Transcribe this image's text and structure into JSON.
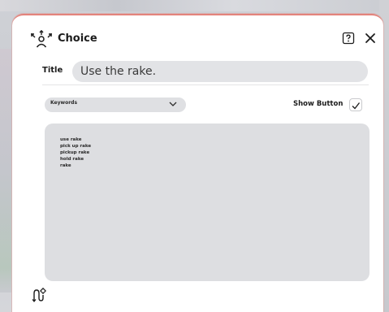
{
  "dialog": {
    "title": "Choice",
    "icons": {
      "header": "choice-people-icon",
      "help": "help-icon",
      "close": "close-icon",
      "footer": "flow-add-icon"
    },
    "accent_color": "#e3837c"
  },
  "title_field": {
    "label": "Title",
    "value": "Use the rake."
  },
  "keywords_select": {
    "selected": "Keywords"
  },
  "show_button": {
    "label": "Show Button",
    "checked": true
  },
  "keywords": [
    "use rake",
    "pick up rake",
    "pickup rake",
    "hold rake",
    "rake"
  ]
}
